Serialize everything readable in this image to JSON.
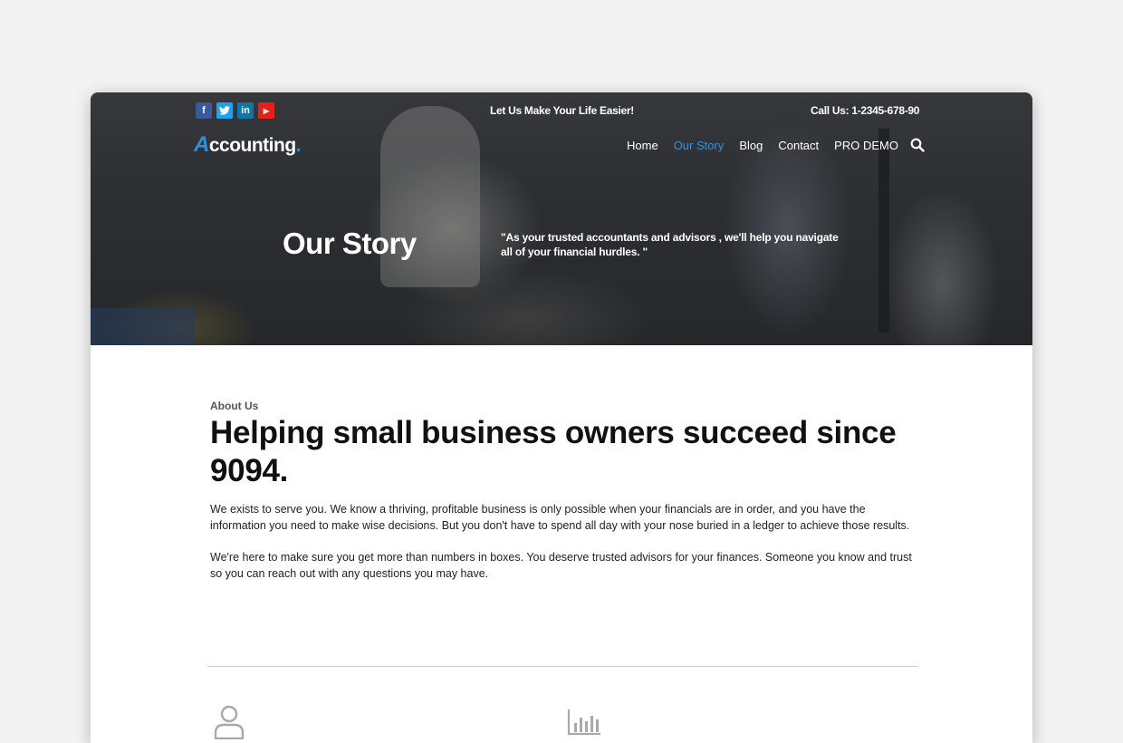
{
  "social": {
    "facebook": "f",
    "twitter": "t",
    "linkedin": "in",
    "youtube": "▶"
  },
  "topbar": {
    "tagline": "Let Us Make Your Life Easier!",
    "call_us": "Call Us: 1-2345-678-90"
  },
  "logo": {
    "initial": "A",
    "rest": "ccounting",
    "dot": "."
  },
  "nav": {
    "items": [
      "Home",
      "Our Story",
      "Blog",
      "Contact",
      "PRO DEMO"
    ],
    "active": "Our Story"
  },
  "hero": {
    "title": "Our Story",
    "quote": "\"As your trusted accountants and advisors , we'll help you navigate all of your financial hurdles. \""
  },
  "about": {
    "eyebrow": "About Us",
    "headline": "Helping small business owners succeed since 9094.",
    "paragraph1": "We exists to serve you. We know a thriving, profitable business is only possible when your financials are in order, and you have the information you need to make wise decisions. But you don't have to spend all day with your nose buried in a ledger to achieve those results.",
    "paragraph2": "We're here to make sure you get more than numbers in boxes. You deserve trusted advisors for your finances. Someone you know and trust so you can reach out with any questions you may have."
  },
  "icons": {
    "features": [
      "user-icon",
      "bar-chart-icon"
    ]
  },
  "colors": {
    "accent": "#3a8fd6",
    "facebook": "#3b5998",
    "twitter": "#1da1f2",
    "linkedin": "#0e76a8",
    "youtube": "#e62117"
  }
}
